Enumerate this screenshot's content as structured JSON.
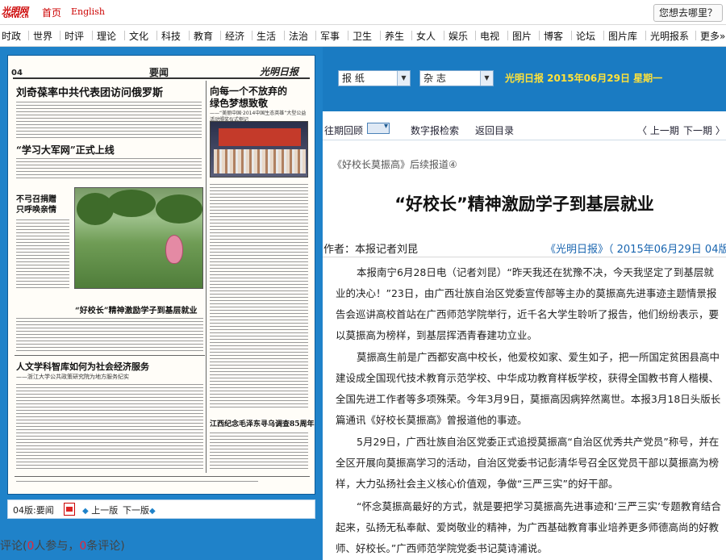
{
  "topbar": {
    "logo_main": "光明网",
    "logo_sub": "GMW.cn",
    "home": "首页",
    "english": "English",
    "search_placeholder": "您想去哪里？"
  },
  "nav": [
    "时政",
    "世界",
    "时评",
    "理论",
    "文化",
    "科技",
    "教育",
    "经济",
    "生活",
    "法治",
    "军事",
    "卫生",
    "养生",
    "女人",
    "娱乐",
    "电视",
    "图片",
    "博客",
    "论坛",
    "图片库",
    "光明报系",
    "更多»"
  ],
  "paper": {
    "page_num": "04",
    "section": "要闻",
    "masthead": "光明日报",
    "headline_1": "刘奇葆率中共代表团访问俄罗斯",
    "headline_2": "“学习大军网”正式上线",
    "headline_3": "不弓召捐赠\n只呼唤亲情",
    "headline_4": "“好校长”精神激励学子到基层就业",
    "headline_5": "人文学科智库如何为社会经济服务",
    "headline_5_sub": "——浙江大学公共政策研究院为地方服务纪实",
    "headline_6": "向每一个不放弃的\n绿色梦想致敬",
    "headline_6_sub": "——“美丽中国·2014中国生态英雄”大型公益活动颁奖仪式侧记",
    "headline_7": "江西纪念毛泽东寻乌调查85周年"
  },
  "pager": {
    "label": "04版:要闻",
    "prev": "上一版",
    "next": "下一版"
  },
  "comment": {
    "prefix": "评论(",
    "participants": "0",
    "middle": "人参与，",
    "comments": "0",
    "suffix": "条评论)"
  },
  "header": {
    "select_paper": "报 纸",
    "select_magazine": "杂 志",
    "date": "光明日报  2015年06月29日  星期一"
  },
  "toolbar": {
    "past": "往期回顾",
    "digital": "数字报检索",
    "back": "返回目录",
    "prev_issue": "〈 上一期",
    "next_issue": "下一期 〉"
  },
  "article": {
    "series": "《好校长莫振高》后续报道④",
    "title": "“好校长”精神激励学子到基层就业",
    "author": "作者：本报记者刘昆",
    "source": "《光明日报》（ 2015年06月29日 04版）",
    "paragraphs": [
      "本报南宁6月28日电（记者刘昆）“昨天我还在犹豫不决，今天我坚定了到基层就业的决心！”23日，由广西壮族自治区党委宣传部等主办的莫振高先进事迹主题情景报告会巡讲高校首站在广西师范学院举行，近千名大学生聆听了报告，他们纷纷表示，要以莫振高为榜样，到基层挥洒青春建功立业。",
      "莫振高生前是广西都安高中校长，他爱校如家、爱生如子，把一所国定贫困县高中建设成全国现代技术教育示范学校、中华成功教育样板学校，获得全国教书育人楷模、全国先进工作者等多项殊荣。今年3月9日，莫振高因病猝然离世。本报3月18日头版长篇通讯《好校长莫振高》曾报道他的事迹。",
      "5月29日，广西壮族自治区党委正式追授莫振高“自治区优秀共产党员”称号，并在全区开展向莫振高学习的活动，自治区党委书记彭清华号召全区党员干部以莫振高为榜样，大力弘扬社会主义核心价值观，争做“三严三实”的好干部。",
      "“怀念莫振高最好的方式，就是要把学习莫振高先进事迹和‘三严三实’专题教育结合起来，弘扬无私奉献、爱岗敬业的精神，为广西基础教育事业培养更多师德高尚的好教师、好校长。”广西师范学院党委书记莫诗浦说。"
    ]
  },
  "colors": {
    "brand_red": "#cc0000",
    "panel_blue": "#1f82c9",
    "header_blue": "#1a7bc2",
    "date_yellow": "#ffe23a",
    "link_blue": "#1a66b0"
  }
}
